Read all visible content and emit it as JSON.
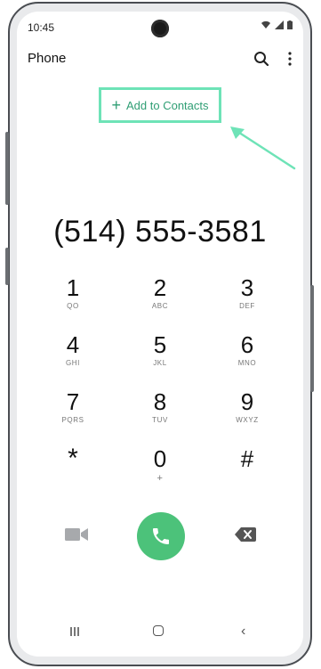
{
  "status_bar": {
    "time": "10:45"
  },
  "header": {
    "title": "Phone",
    "search_icon": "search-icon",
    "more_icon": "more-vert-icon"
  },
  "add_contacts": {
    "plus": "+",
    "label": "Add to Contacts"
  },
  "dialer": {
    "number": "(514) 555-3581"
  },
  "keypad": [
    {
      "digit": "1",
      "letters": "QO"
    },
    {
      "digit": "2",
      "letters": "ABC"
    },
    {
      "digit": "3",
      "letters": "DEF"
    },
    {
      "digit": "4",
      "letters": "GHI"
    },
    {
      "digit": "5",
      "letters": "JKL"
    },
    {
      "digit": "6",
      "letters": "MNO"
    },
    {
      "digit": "7",
      "letters": "PQRS"
    },
    {
      "digit": "8",
      "letters": "TUV"
    },
    {
      "digit": "9",
      "letters": "WXYZ"
    },
    {
      "digit": "*",
      "letters": ""
    },
    {
      "digit": "0",
      "letters": "+"
    },
    {
      "digit": "#",
      "letters": ""
    }
  ],
  "colors": {
    "accent": "#4cc27a",
    "highlight": "#6ee3b7",
    "link_text": "#2f9e74"
  },
  "navbar": {
    "back": "‹"
  }
}
